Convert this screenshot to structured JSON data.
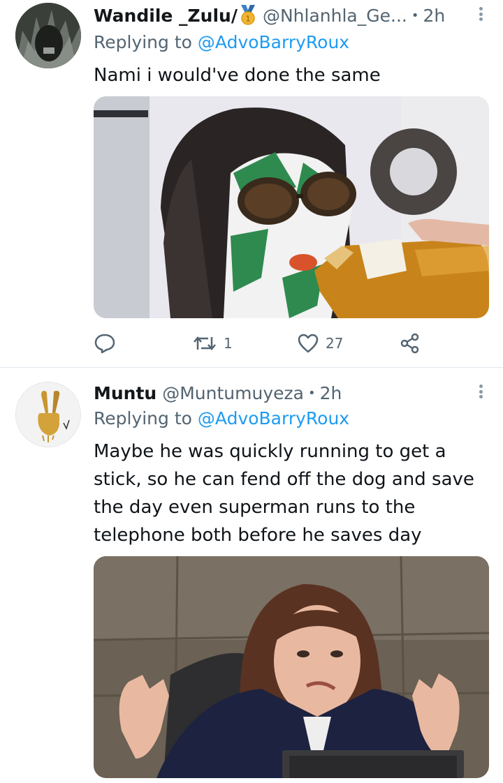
{
  "tweets": [
    {
      "author_name": "Wandile _Zulu/",
      "author_badge_icon": "gold-medal-icon",
      "author_handle": "@Nhlanhla_Ge...",
      "timestamp": "2h",
      "replying_to_prefix": "Replying to",
      "replying_to_handle": "@AdvoBarryRoux",
      "text": "Nami i would've done the same",
      "actions": {
        "reply_count": "",
        "retweet_count": "1",
        "like_count": "27"
      }
    },
    {
      "author_name": "Muntu",
      "author_handle": "@Muntumuyeza",
      "timestamp": "2h",
      "replying_to_prefix": "Replying to",
      "replying_to_handle": "@AdvoBarryRoux",
      "text": "Maybe he was quickly running to get a stick, so he can fend off the dog and save the day even superman runs to the telephone both before he saves day"
    }
  ],
  "colors": {
    "accent": "#1d9bf0",
    "secondary_text": "#536471",
    "divider": "#e1e8ed"
  }
}
